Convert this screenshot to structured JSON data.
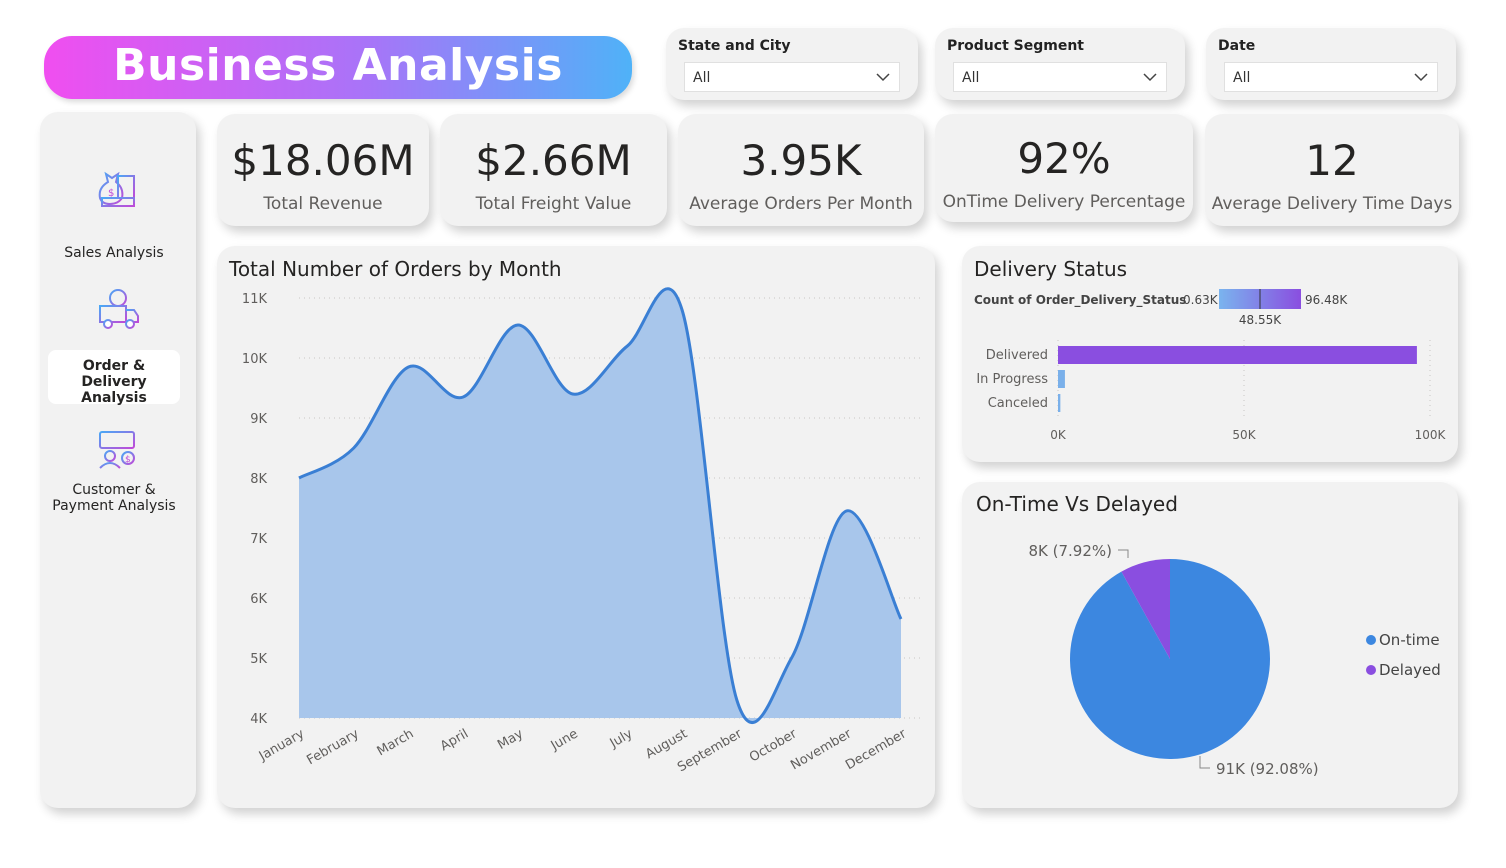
{
  "header": {
    "title": "Business Analysis"
  },
  "filters": [
    {
      "label": "State and City",
      "value": "All"
    },
    {
      "label": "Product Segment",
      "value": "All"
    },
    {
      "label": "Date",
      "value": "All"
    }
  ],
  "nav": {
    "items": [
      {
        "label": "Sales Analysis",
        "icon": "money-bag-icon"
      },
      {
        "label": "Order & Delivery Analysis",
        "line1": "Order & Delivery",
        "line2": "Analysis",
        "icon": "delivery-truck-icon",
        "active": true
      },
      {
        "label": "Customer & Payment Analysis",
        "line1": "Customer &",
        "line2": "Payment Analysis",
        "icon": "customer-payment-icon"
      }
    ]
  },
  "kpis": [
    {
      "value": "$18.06M",
      "caption": "Total Revenue"
    },
    {
      "value": "$2.66M",
      "caption": "Total Freight Value"
    },
    {
      "value": "3.95K",
      "caption": "Average Orders Per Month"
    },
    {
      "value": "92%",
      "caption": "OnTime Delivery Percentage"
    },
    {
      "value": "12",
      "caption": "Average Delivery Time Days"
    }
  ],
  "colors": {
    "line": "#3a7fd4",
    "area": "#a8c6eb",
    "delivered": "#8a4ee0",
    "small_bar": "#7ab0ea",
    "ontime": "#3c87e0",
    "delayed": "#8a4ee0"
  },
  "chart_data": [
    {
      "type": "area",
      "title": "Total Number of Orders by Month",
      "categories": [
        "January",
        "February",
        "March",
        "April",
        "May",
        "June",
        "July",
        "August",
        "September",
        "October",
        "November",
        "December"
      ],
      "values": [
        8000,
        8500,
        9850,
        9350,
        10550,
        9400,
        10200,
        10800,
        4300,
        5000,
        7450,
        5650
      ],
      "yticks": [
        "11K",
        "10K",
        "9K",
        "8K",
        "7K",
        "6K",
        "5K",
        "4K"
      ],
      "ylim": [
        4000,
        11000
      ],
      "grid": true
    },
    {
      "type": "bar",
      "title": "Delivery Status",
      "legend_title": "Count of Order_Delivery_Status",
      "legend_min": "0.63K",
      "legend_mid": "48.55K",
      "legend_max": "96.48K",
      "categories": [
        "Delivered",
        "In Progress",
        "Canceled"
      ],
      "values": [
        96480,
        1860,
        630
      ],
      "xticks": [
        "0K",
        "50K",
        "100K"
      ],
      "xlim": [
        0,
        100000
      ]
    },
    {
      "type": "pie",
      "title": "On-Time Vs Delayed",
      "labels": [
        "On-time",
        "Delayed"
      ],
      "values": [
        91000,
        8000
      ],
      "percentages": [
        92.08,
        7.92
      ],
      "data_labels": [
        "91K (92.08%)",
        "8K (7.92%)"
      ],
      "legend": "right"
    }
  ]
}
